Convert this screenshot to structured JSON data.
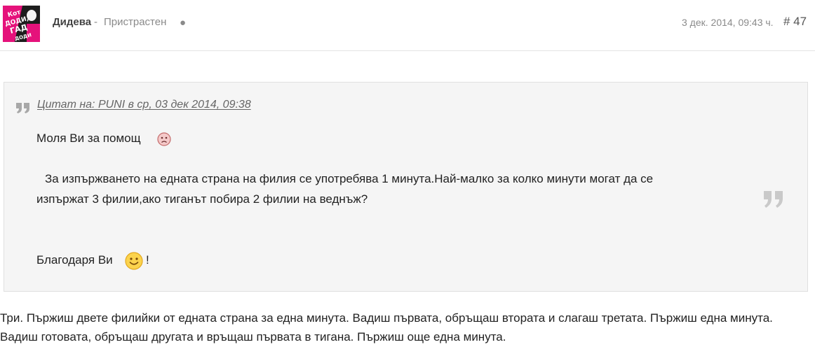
{
  "avatar": {
    "alt": "Дидева",
    "lines": [
      "Кот",
      "ДОДИ,",
      "ГАД",
      "ДОДИ"
    ]
  },
  "post": {
    "username": "Дидева",
    "separator": "-",
    "rank": "Пристрастен",
    "status_dot": "●",
    "date": "3 дек. 2014, 09:43 ч.",
    "number": "# 47"
  },
  "quote": {
    "source": "Цитат на: PUNI в ср, 03 дек 2014, 09:38",
    "line1": "Моля Ви за помощ",
    "line2": "За изпържването на едната страна на филия се употребява 1 минута.Най-малко за колко минути могат да се",
    "line3": "изпържат 3 филии,ако тиганът побира 2 филии на веднъж?",
    "line4": "Благодаря Ви",
    "line4_end": "!",
    "icons": [
      "quote-open-icon",
      "sad-face-icon",
      "smile-face-icon",
      "quote-close-icon"
    ]
  },
  "reply": {
    "text": "Три. Пържиш двете филийки от едната страна за една минута. Вадиш първата, обръщаш втората и слагаш третата. Пържиш една минута. Вадиш готовата, обръщаш другата и връщаш първата в тигана. Пържиш още една минута."
  },
  "colors": {
    "avatar_pink": "#e5127b",
    "avatar_dark": "#1d1d1d",
    "quote_bg": "#f5f5f5",
    "muted_text": "#8a8a8a"
  }
}
